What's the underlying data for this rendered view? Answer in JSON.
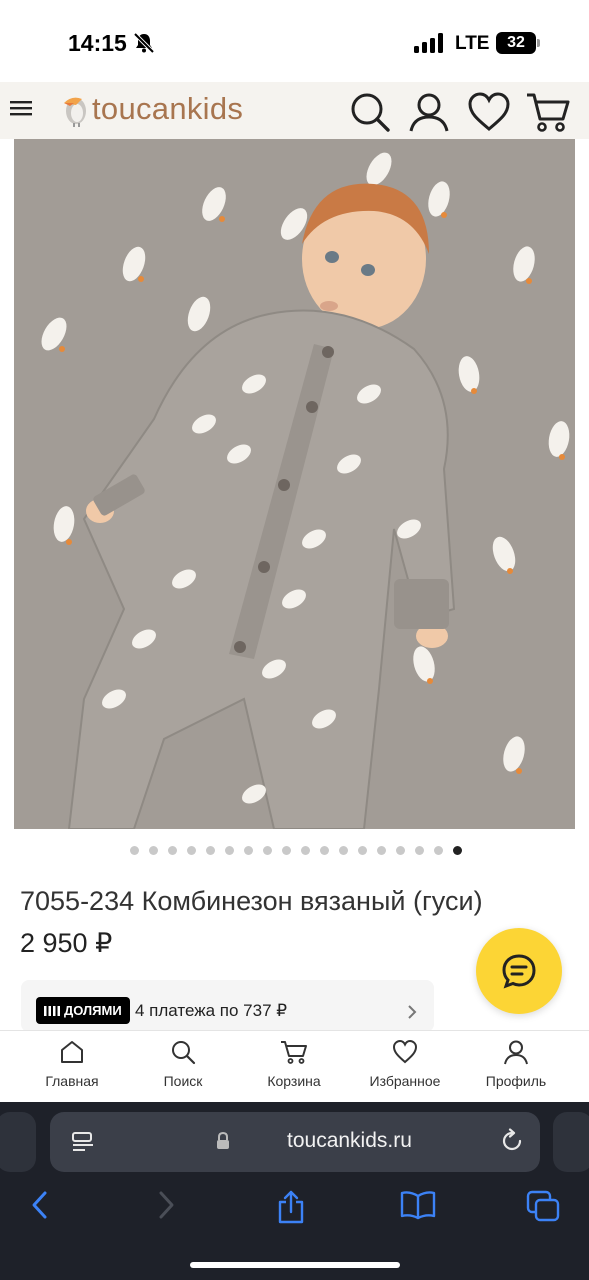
{
  "status_bar": {
    "time": "14:15",
    "network": "LTE",
    "battery": "32"
  },
  "header": {
    "logo_text": "toucankids",
    "icons": [
      "menu-icon",
      "search-icon",
      "profile-icon",
      "heart-icon",
      "cart-icon"
    ]
  },
  "product": {
    "image_description_icon": "product-photo",
    "title": "7055-234 Комбинезон вязаный (гуси)",
    "price": "2 950 ₽",
    "carousel": {
      "total": 18,
      "active_index": 17
    }
  },
  "installment": {
    "badge": "ДОЛЯМИ",
    "text": "4 платежа по 737 ₽"
  },
  "tab_bar": {
    "tabs": [
      {
        "label": "Главная",
        "icon": "home-icon"
      },
      {
        "label": "Поиск",
        "icon": "search-icon"
      },
      {
        "label": "Корзина",
        "icon": "cart-icon"
      },
      {
        "label": "Избранное",
        "icon": "heart-icon"
      },
      {
        "label": "Профиль",
        "icon": "profile-icon"
      }
    ]
  },
  "browser": {
    "url": "toucankids.ru"
  },
  "colors": {
    "logo": "#a8754f",
    "chat_button": "#fcd535",
    "header_bg": "#f5f3ef",
    "safari_accent": "#3c82f6",
    "safari_bg": "#1e2129"
  }
}
